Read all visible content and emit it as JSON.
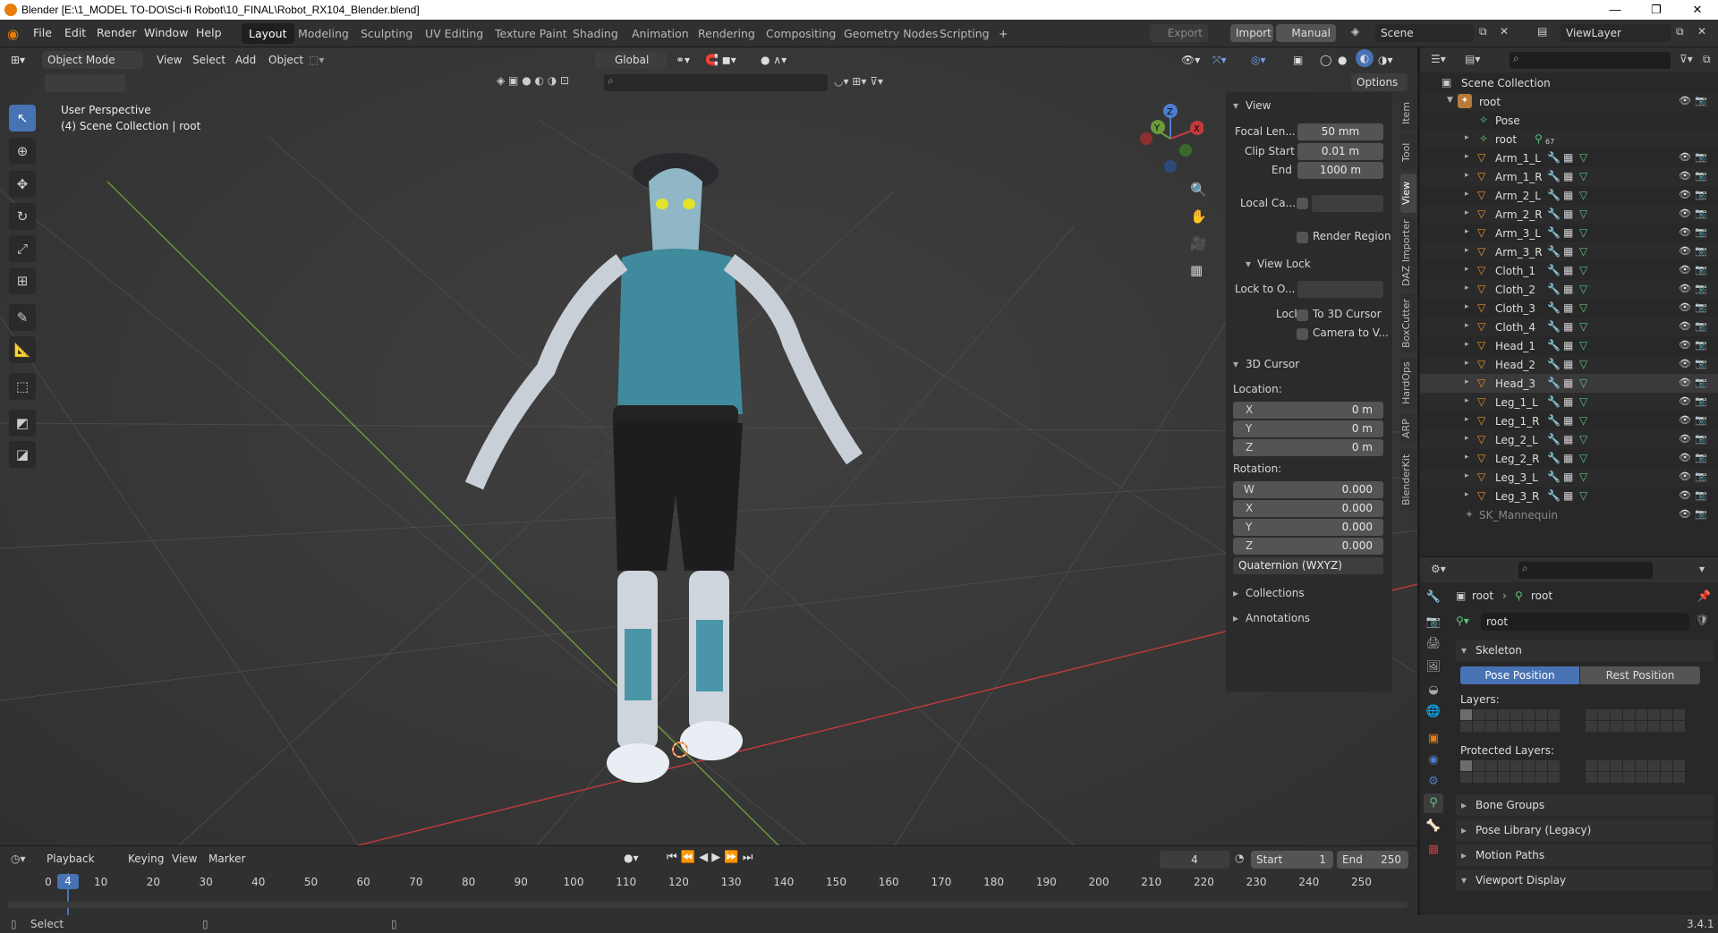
{
  "window": {
    "title": "Blender [E:\\1_MODEL TO-DO\\Sci-fi Robot\\10_FINAL\\Robot_RX104_Blender.blend]",
    "minimize": "—",
    "maximize": "❐",
    "close": "✕"
  },
  "menus": [
    "File",
    "Edit",
    "Render",
    "Window",
    "Help"
  ],
  "workspaces": [
    "Layout",
    "Modeling",
    "Sculpting",
    "UV Editing",
    "Texture Paint",
    "Shading",
    "Animation",
    "Rendering",
    "Compositing",
    "Geometry Nodes",
    "Scripting"
  ],
  "workspace_add": "+",
  "topright": {
    "export": "Export",
    "import": "Import",
    "manual": "Manual",
    "scene": "Scene",
    "viewlayer": "ViewLayer"
  },
  "viewport": {
    "mode": "Object Mode",
    "view": "View",
    "select": "Select",
    "add": "Add",
    "object": "Object",
    "orientation": "Global",
    "options": "Options",
    "perspective": "User Perspective",
    "collection_info": "(4) Scene Collection | root",
    "gizmo": {
      "z": "Z",
      "y": "Y",
      "x": "X"
    }
  },
  "npanel": {
    "view_header": "View",
    "focal_label": "Focal Len...",
    "focal_value": "50 mm",
    "clip_start_label": "Clip Start",
    "clip_start_value": "0.01 m",
    "clip_end_label": "End",
    "clip_end_value": "1000 m",
    "local_cam_label": "Local Ca...",
    "render_region": "Render Region",
    "view_lock_header": "View Lock",
    "lock_to_label": "Lock to O...",
    "lock_label": "Lock",
    "to_3d_cursor": "To 3D Cursor",
    "camera_to_view": "Camera to V...",
    "cursor_header": "3D Cursor",
    "location_label": "Location:",
    "loc": [
      {
        "axis": "X",
        "value": "0 m"
      },
      {
        "axis": "Y",
        "value": "0 m"
      },
      {
        "axis": "Z",
        "value": "0 m"
      }
    ],
    "rotation_label": "Rotation:",
    "rot": [
      {
        "axis": "W",
        "value": "0.000"
      },
      {
        "axis": "X",
        "value": "0.000"
      },
      {
        "axis": "Y",
        "value": "0.000"
      },
      {
        "axis": "Z",
        "value": "0.000"
      }
    ],
    "rot_mode": "Quaternion (WXYZ)",
    "collections": "Collections",
    "annotations": "Annotations",
    "tabs": [
      "Item",
      "Tool",
      "View",
      "DAZ Importer",
      "BoxCutter",
      "HardOps",
      "ARP",
      "BlenderKit"
    ]
  },
  "timeline": {
    "playback": "Playback",
    "keying": "Keying",
    "view": "View",
    "marker": "Marker",
    "current_frame": "4",
    "start_label": "Start",
    "start": "1",
    "end_label": "End",
    "end": "250",
    "ticks": [
      "0",
      "10",
      "20",
      "30",
      "40",
      "50",
      "60",
      "70",
      "80",
      "90",
      "100",
      "110",
      "120",
      "130",
      "140",
      "150",
      "160",
      "170",
      "180",
      "190",
      "200",
      "210",
      "220",
      "230",
      "240",
      "250"
    ]
  },
  "status": {
    "select": "Select",
    "version": "3.4.1"
  },
  "outliner": {
    "scene_collection": "Scene Collection",
    "root": "root",
    "pose": "Pose",
    "root_armature": "root",
    "root_count": "67",
    "objects": [
      "Arm_1_L",
      "Arm_1_R",
      "Arm_2_L",
      "Arm_2_R",
      "Arm_3_L",
      "Arm_3_R",
      "Cloth_1",
      "Cloth_2",
      "Cloth_3",
      "Cloth_4",
      "Head_1",
      "Head_2",
      "Head_3",
      "Leg_1_L",
      "Leg_1_R",
      "Leg_2_L",
      "Leg_2_R",
      "Leg_3_L",
      "Leg_3_R"
    ],
    "mannequin": "SK_Mannequin"
  },
  "properties": {
    "crumb1": "root",
    "crumb2": "root",
    "data_name": "root",
    "skeleton": "Skeleton",
    "pose_position": "Pose Position",
    "rest_position": "Rest Position",
    "layers": "Layers:",
    "protected_layers": "Protected Layers:",
    "bone_groups": "Bone Groups",
    "pose_library": "Pose Library (Legacy)",
    "motion_paths": "Motion Paths",
    "viewport_display": "Viewport Display"
  },
  "colors": {
    "accent": "#4772b3",
    "orange": "#e87d0d",
    "mesh_green": "#59c77a",
    "axis_red": "#c43b3b",
    "axis_green": "#6b9a3b"
  }
}
